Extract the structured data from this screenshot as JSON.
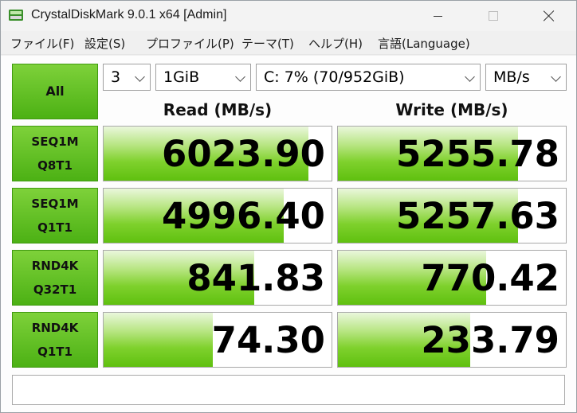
{
  "window": {
    "title": "CrystalDiskMark 9.0.1 x64 [Admin]"
  },
  "menu": {
    "items": [
      "ファイル(F)",
      "設定(S)",
      "プロファイル(P)",
      "テーマ(T)",
      "ヘルプ(H)",
      "言語(Language)"
    ]
  },
  "controls": {
    "all_label": "All",
    "count_value": "3",
    "size_value": "1GiB",
    "drive_value": "C: 7% (70/952GiB)",
    "unit_value": "MB/s"
  },
  "headers": {
    "read": "Read (MB/s)",
    "write": "Write (MB/s)"
  },
  "tests": [
    {
      "line1": "SEQ1M",
      "line2": "Q8T1",
      "read": "6023.90",
      "write": "5255.78",
      "read_fill": 0.9,
      "write_fill": 0.79
    },
    {
      "line1": "SEQ1M",
      "line2": "Q1T1",
      "read": "4996.40",
      "write": "5257.63",
      "read_fill": 0.79,
      "write_fill": 0.79
    },
    {
      "line1": "RND4K",
      "line2": "Q32T1",
      "read": "841.83",
      "write": "770.42",
      "read_fill": 0.66,
      "write_fill": 0.65
    },
    {
      "line1": "RND4K",
      "line2": "Q1T1",
      "read": "74.30",
      "write": "233.79",
      "read_fill": 0.48,
      "write_fill": 0.58
    }
  ],
  "comment": "",
  "colors": {
    "accent_green": "#5fc00f",
    "button_green": "#7ed13a"
  }
}
